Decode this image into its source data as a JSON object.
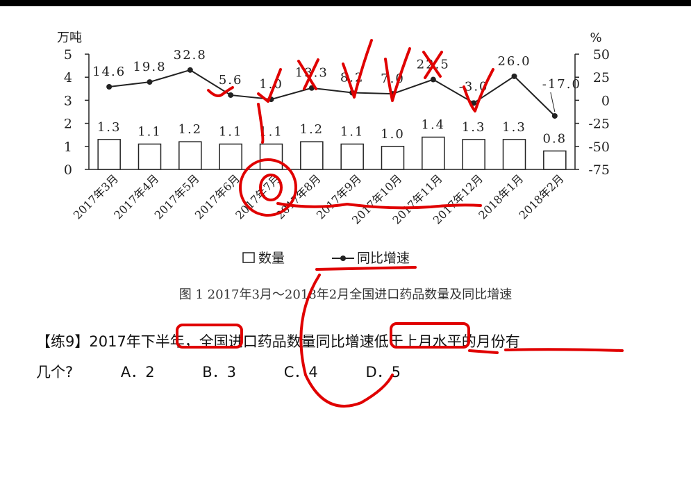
{
  "chart_data": {
    "type": "bar",
    "categories": [
      "2017年3月",
      "2017年4月",
      "2017年5月",
      "2017年6月",
      "2017年7月",
      "2017年8月",
      "2017年9月",
      "2017年10月",
      "2017年11月",
      "2017年12月",
      "2018年1月",
      "2018年2月"
    ],
    "series": [
      {
        "name": "数量",
        "type": "bar",
        "axis": "left",
        "values": [
          1.3,
          1.1,
          1.2,
          1.1,
          1.1,
          1.2,
          1.1,
          1.0,
          1.4,
          1.3,
          1.3,
          0.8
        ]
      },
      {
        "name": "同比增速",
        "type": "line",
        "axis": "right",
        "values": [
          14.6,
          19.8,
          32.8,
          5.6,
          1.0,
          13.3,
          8.2,
          7.0,
          22.5,
          -3.0,
          26.0,
          -17.0
        ]
      }
    ],
    "bar_labels": [
      "1.3",
      "1.1",
      "1.2",
      "1.1",
      "1.1",
      "1.2",
      "1.1",
      "1.0",
      "1.4",
      "1.3",
      "1.3",
      "0.8"
    ],
    "line_labels": [
      "14.6",
      "19.8",
      "32.8",
      "5.6",
      "1.0",
      "13.3",
      "8.2",
      "7.0",
      "22.5",
      "-3.0",
      "26.0",
      "-17.0"
    ],
    "left_axis": {
      "unit": "万吨",
      "range": [
        0,
        5
      ],
      "ticks": [
        "0",
        "1",
        "2",
        "3",
        "4",
        "5"
      ]
    },
    "right_axis": {
      "unit": "%",
      "range": [
        -75,
        50
      ],
      "ticks": [
        "-75",
        "-50",
        "-25",
        "0",
        "25",
        "50"
      ]
    },
    "legend_placement": "bottom-center",
    "grid": false,
    "title": "图 1    2017年3月～2018年2月全国进口药品数量及同比增速"
  },
  "question": {
    "line1": "【练9】2017年下半年，全国进口药品数量同比增速低于上月水平的月份有",
    "line2": "几个?",
    "options": [
      "A．2",
      "B．3",
      "C．4",
      "D．5"
    ]
  },
  "colors": {
    "ink": "#e00000",
    "chart": "#222222"
  }
}
